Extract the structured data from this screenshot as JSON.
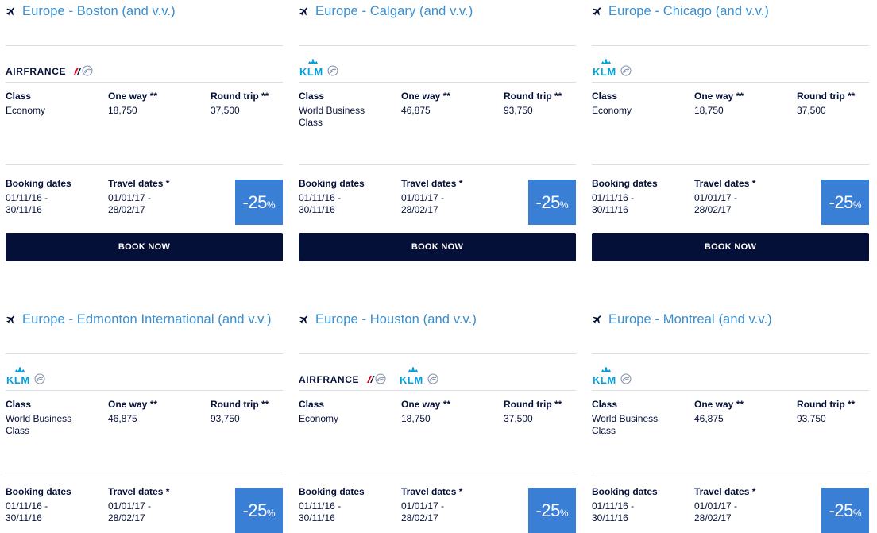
{
  "labels": {
    "class": "Class",
    "one_way": "One way **",
    "round_trip": "Round trip **",
    "booking_dates": "Booking dates",
    "travel_dates": "Travel dates *",
    "book_now": "BOOK NOW",
    "discount_number": "-25",
    "discount_unit": "%"
  },
  "airline_logos": {
    "airfrance": "AIRFRANCE",
    "klm": "KLM"
  },
  "colors": {
    "title_blue": "#3a8fd0",
    "navy": "#051039",
    "badge_blue": "#3a7fd6",
    "airfrance_red": "#e2001a",
    "klm_blue": "#00a1de"
  },
  "offers": [
    {
      "route": "Europe - Boston (and v.v.)",
      "airlines": [
        "airfrance"
      ],
      "class": "Economy",
      "one_way": "18,750",
      "round_trip": "37,500",
      "booking_dates": "01/11/16 -\n30/11/16",
      "travel_dates": "01/01/17 -\n28/02/17"
    },
    {
      "route": "Europe - Calgary (and v.v.)",
      "airlines": [
        "klm"
      ],
      "class": "World Business\nClass",
      "one_way": "46,875",
      "round_trip": "93,750",
      "booking_dates": "01/11/16 -\n30/11/16",
      "travel_dates": "01/01/17 -\n28/02/17"
    },
    {
      "route": "Europe - Chicago (and v.v.)",
      "airlines": [
        "klm"
      ],
      "class": "Economy",
      "one_way": "18,750",
      "round_trip": "37,500",
      "booking_dates": "01/11/16 -\n30/11/16",
      "travel_dates": "01/01/17 -\n28/02/17"
    },
    {
      "route": "Europe - Edmonton International (and v.v.)",
      "airlines": [
        "klm"
      ],
      "class": "World Business\nClass",
      "one_way": "46,875",
      "round_trip": "93,750",
      "booking_dates": "01/11/16 -\n30/11/16",
      "travel_dates": "01/01/17 -\n28/02/17"
    },
    {
      "route": "Europe - Houston (and v.v.)",
      "airlines": [
        "airfrance",
        "klm"
      ],
      "class": "Economy",
      "one_way": "18,750",
      "round_trip": "37,500",
      "booking_dates": "01/11/16 -\n30/11/16",
      "travel_dates": "01/01/17 -\n28/02/17"
    },
    {
      "route": "Europe - Montreal (and v.v.)",
      "airlines": [
        "klm"
      ],
      "class": "World Business\nClass",
      "one_way": "46,875",
      "round_trip": "93,750",
      "booking_dates": "01/11/16 -\n30/11/16",
      "travel_dates": "01/01/17 -\n28/02/17"
    }
  ]
}
